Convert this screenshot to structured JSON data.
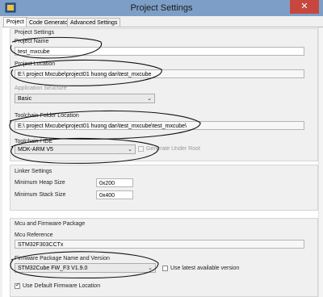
{
  "window": {
    "title": "Project Settings",
    "close_glyph": "✕",
    "icon": "mxcube-app-icon"
  },
  "tabs": [
    {
      "label": "Project",
      "active": true
    },
    {
      "label": "Code Generator",
      "active": false
    },
    {
      "label": "Advanced Settings",
      "active": false
    }
  ],
  "project_settings": {
    "section_title": "Project Settings",
    "project_name": {
      "label": "Project Name",
      "value": "test_mxcube"
    },
    "project_location": {
      "label": "Project Location",
      "value": "E:\\ project Mxcube\\project01 huong dan\\test_mxcube"
    },
    "application_structure": {
      "label": "Application Structure",
      "value": "Basic"
    },
    "toolchain_folder_location": {
      "label": "Toolchain Folder Location",
      "value": "E:\\ project Mxcube\\project01 huong dan\\test_mxcube\\test_mxcube\\"
    },
    "toolchain_ide": {
      "label": "Toolchain / IDE",
      "value": "MDK-ARM V5"
    },
    "generate_under_root": {
      "label": "Generate Under Root",
      "checked": false,
      "enabled": false
    }
  },
  "linker_settings": {
    "section_title": "Linker Settings",
    "min_heap": {
      "label": "Minimum Heap Size",
      "value": "0x200"
    },
    "min_stack": {
      "label": "Minimum Stack Size",
      "value": "0x400"
    }
  },
  "mcu_firmware": {
    "section_title": "Mcu and Firmware Package",
    "mcu_reference": {
      "label": "Mcu Reference",
      "value": "STM32F303CCTx"
    },
    "firmware_package": {
      "label": "Firmware Package Name and Version",
      "value": "STM32Cube FW_F3 V1.9.0"
    },
    "use_latest": {
      "label": "Use latest available version",
      "checked": false
    },
    "use_default_location": {
      "label": "Use Default Firmware Location",
      "checked": true
    }
  },
  "colors": {
    "titlebar": "#7d9fc7",
    "close": "#c7473f",
    "panel": "#f0f0f0",
    "annotation_ink": "#111111"
  }
}
